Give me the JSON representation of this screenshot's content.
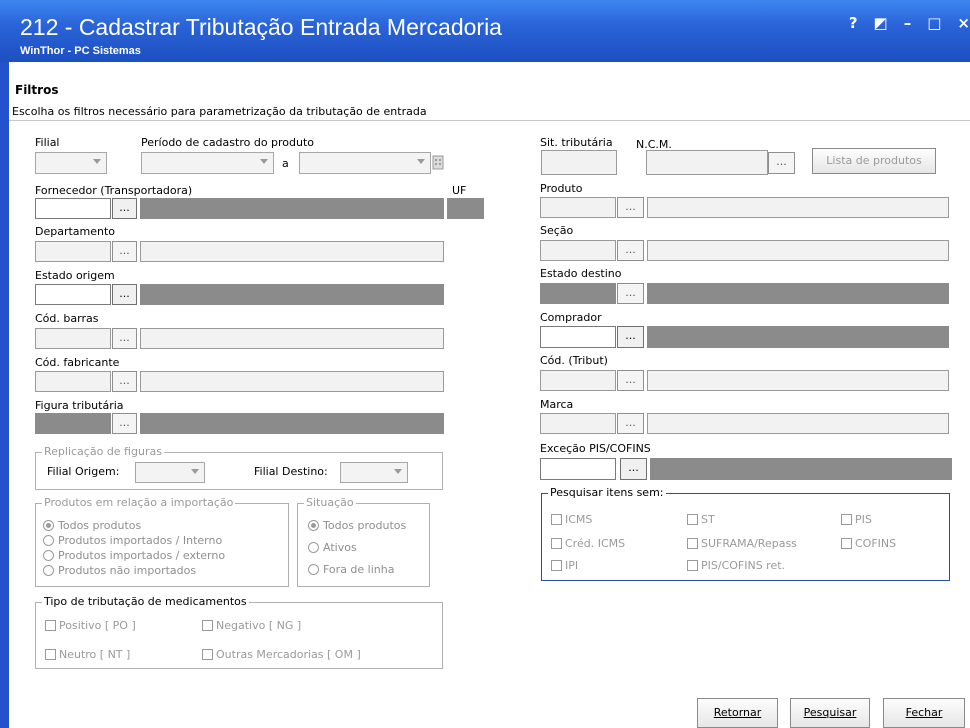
{
  "window": {
    "title": "212 - Cadastrar Tributação Entrada Mercadoria",
    "subtitle": "WinThor - PC Sistemas",
    "controls": [
      "?",
      "◩",
      "–",
      "□",
      "×"
    ]
  },
  "header": {
    "section_title": "Filtros",
    "description": "Escolha os filtros necessário para parametrização da tributação de entrada"
  },
  "left": {
    "filial_label": "Filial",
    "periodo_label": "Período de cadastro do produto",
    "periodo_sep": "a",
    "fornecedor_label": "Fornecedor (Transportadora)",
    "uf_label": "UF",
    "departamento_label": "Departamento",
    "estado_origem_label": "Estado origem",
    "cod_barras_label": "Cód. barras",
    "cod_fabricante_label": "Cód. fabricante",
    "figura_label": "Figura tributária",
    "replicacao": {
      "title": "Replicação de figuras",
      "filial_origem": "Filial Origem:",
      "filial_destino": "Filial Destino:"
    },
    "produtos_importacao": {
      "title": "Produtos em relação a importação",
      "options": [
        "Todos produtos",
        "Produtos importados / Interno",
        "Produtos importados / externo",
        "Produtos não importados"
      ],
      "selected": "Todos produtos"
    },
    "situacao": {
      "title": "Situação",
      "options": [
        "Todos produtos",
        "Ativos",
        "Fora de linha"
      ],
      "selected": "Todos produtos"
    },
    "medicamentos": {
      "title": "Tipo de tributação de medicamentos",
      "options": [
        "Positivo [ PO ]",
        "Negativo [ NG ]",
        "Neutro [ NT ]",
        "Outras Mercadorias [ OM ]"
      ]
    }
  },
  "right": {
    "sit_label": "Sit. tributária",
    "ncm_label": "N.C.M.",
    "lista_button": "Lista de produtos",
    "produto_label": "Produto",
    "secao_label": "Seção",
    "estado_destino_label": "Estado destino",
    "comprador_label": "Comprador",
    "cod_tribut_label": "Cód. (Tribut)",
    "marca_label": "Marca",
    "excecao_label": "Exceção PIS/COFINS",
    "pesquisar_itens": {
      "title": "Pesquisar itens sem:",
      "options": [
        "ICMS",
        "ST",
        "PIS",
        "Créd. ICMS",
        "SUFRAMA/Repass",
        "COFINS",
        "IPI",
        "PIS/COFINS ret."
      ]
    }
  },
  "ellipsis": "...",
  "footer": {
    "retornar": "Retornar",
    "pesquisar": "Pesquisar",
    "fechar": "Fechar"
  },
  "colors": {
    "titlebar": "#2a64d8",
    "disabled_field": "#8b8b8b",
    "group_border_blue": "#2d4f9a"
  }
}
